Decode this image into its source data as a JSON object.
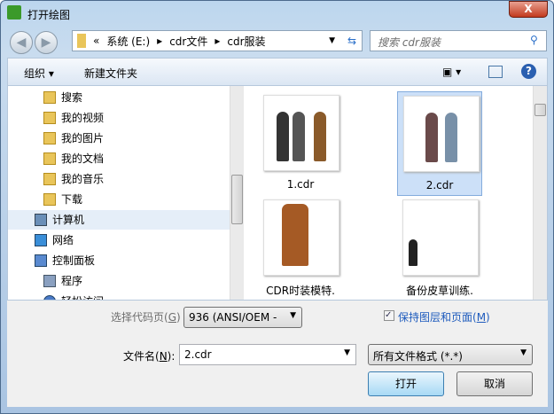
{
  "window": {
    "title": "打开绘图",
    "close": "X"
  },
  "address": {
    "overflow": "«",
    "crumbs": [
      "系统 (E:)",
      "cdr文件",
      "cdr服装"
    ],
    "search_placeholder": "搜索 cdr服装"
  },
  "toolbar": {
    "organize": "组织 ▾",
    "new_folder": "新建文件夹"
  },
  "tree": [
    {
      "label": "搜索",
      "icon": "folder-icon"
    },
    {
      "label": "我的视频",
      "icon": "folder-icon"
    },
    {
      "label": "我的图片",
      "icon": "folder-icon"
    },
    {
      "label": "我的文档",
      "icon": "folder-icon"
    },
    {
      "label": "我的音乐",
      "icon": "folder-icon"
    },
    {
      "label": "下载",
      "icon": "download-folder-icon"
    },
    {
      "label": "计算机",
      "icon": "computer-icon"
    },
    {
      "label": "网络",
      "icon": "network-icon"
    },
    {
      "label": "控制面板",
      "icon": "control-panel-icon"
    },
    {
      "label": "程序",
      "icon": "programs-icon"
    },
    {
      "label": "轻松访问",
      "icon": "accessibility-icon"
    }
  ],
  "files": [
    {
      "name": "1.cdr",
      "selected": false
    },
    {
      "name": "2.cdr",
      "selected": true
    },
    {
      "name": "CDR时装模特.",
      "selected": false
    },
    {
      "name": "备份皮草训练.",
      "selected": false
    }
  ],
  "codepage": {
    "label": "选择代码页(",
    "key": "G",
    "end": ")",
    "value": "936   (ANSI/OEM -"
  },
  "keep_layers": {
    "label": "保持图层和页面(",
    "key": "M",
    "end": ")",
    "checked": true
  },
  "filename": {
    "label": "文件名(",
    "key": "N",
    "end": "):",
    "value": "2.cdr"
  },
  "filetype": {
    "value": "所有文件格式 (*.*)"
  },
  "buttons": {
    "open": "打开",
    "cancel": "取消"
  }
}
